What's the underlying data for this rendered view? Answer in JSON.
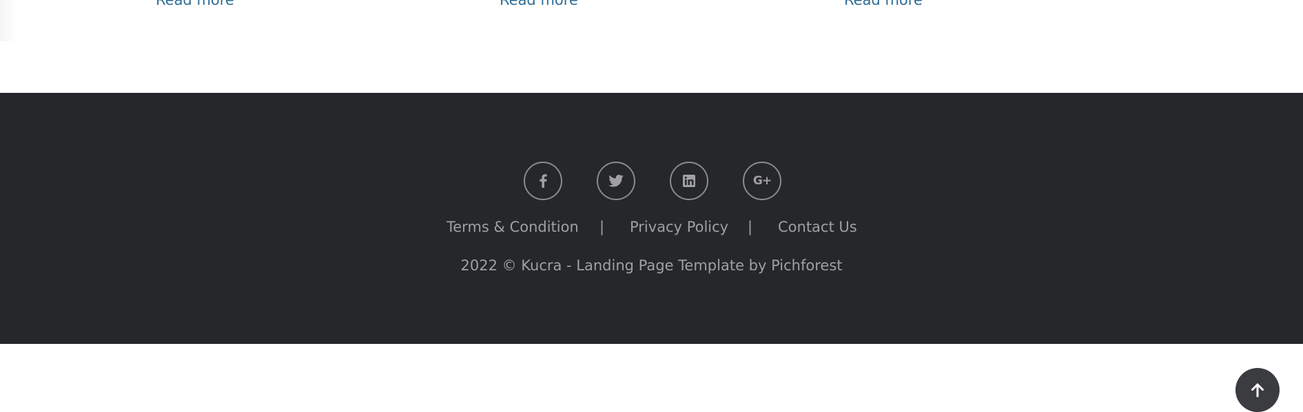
{
  "cards": {
    "read_more_labels": [
      "Read more",
      "Read more",
      "Read more"
    ]
  },
  "footer": {
    "social": [
      {
        "name": "Facebook",
        "icon": "facebook-icon"
      },
      {
        "name": "Twitter",
        "icon": "twitter-icon"
      },
      {
        "name": "LinkedIn",
        "icon": "linkedin-icon"
      },
      {
        "name": "Google Plus",
        "icon": "google-plus-icon",
        "glyph": "G+"
      }
    ],
    "links": {
      "terms": "Terms & Condition",
      "privacy": "Privacy Policy",
      "contact": "Contact Us",
      "separator": "|"
    },
    "copyright": "2022 © Kucra - Landing Page Template by Pichforest"
  },
  "back_to_top": {
    "icon": "arrow-up-icon"
  },
  "colors": {
    "footer_bg": "#26272b",
    "link_blue": "#2f6c96",
    "footer_text": "#9fa0a3",
    "back_to_top_bg": "#3b3c40"
  }
}
